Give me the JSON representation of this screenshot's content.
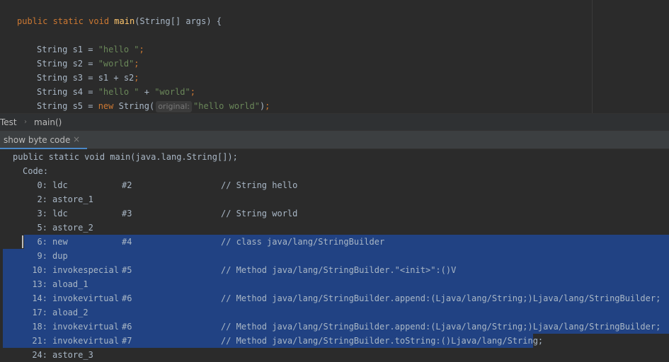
{
  "editor": {
    "lines": [
      {
        "parts": [
          {
            "text": "public static void ",
            "cls": "kw"
          },
          {
            "text": "main",
            "cls": "fn"
          },
          {
            "text": "(String[] args) {",
            "cls": "plain"
          }
        ]
      },
      {
        "parts": [
          {
            "text": "String s1 = ",
            "cls": "plain"
          },
          {
            "text": "\"hello \"",
            "cls": "str"
          },
          {
            "text": ";",
            "cls": "kw"
          }
        ]
      },
      {
        "parts": [
          {
            "text": "String s2 = ",
            "cls": "plain"
          },
          {
            "text": "\"world\"",
            "cls": "str"
          },
          {
            "text": ";",
            "cls": "kw"
          }
        ]
      },
      {
        "parts": [
          {
            "text": "String s3 = s1 + s2",
            "cls": "plain"
          },
          {
            "text": ";",
            "cls": "kw"
          }
        ]
      },
      {
        "parts": [
          {
            "text": "String s4 = ",
            "cls": "plain"
          },
          {
            "text": "\"hello \"",
            "cls": "str"
          },
          {
            "text": " + ",
            "cls": "plain"
          },
          {
            "text": "\"world\"",
            "cls": "str"
          },
          {
            "text": ";",
            "cls": "kw"
          }
        ]
      },
      {
        "parts": [
          {
            "text": "String s5 = ",
            "cls": "plain"
          },
          {
            "text": "new ",
            "cls": "kw"
          },
          {
            "text": "String(",
            "cls": "plain"
          },
          {
            "text": "original:",
            "cls": "hint"
          },
          {
            "text": "\"hello world\"",
            "cls": "str"
          },
          {
            "text": ")",
            "cls": "plain"
          },
          {
            "text": ";",
            "cls": "kw"
          }
        ]
      }
    ]
  },
  "breadcrumb": {
    "class_name": "Test",
    "method_name": "main()"
  },
  "tool_window": {
    "tab_label": "show byte code",
    "close_glyph": "×"
  },
  "bytecode": {
    "signature": "public static void main(java.lang.String[]);",
    "code_label": "Code:",
    "instructions": [
      {
        "offset": "0:",
        "op": "ldc",
        "arg": "#2",
        "comment": "// String hello",
        "selected": false
      },
      {
        "offset": "2:",
        "op": "astore_1",
        "arg": "",
        "comment": "",
        "selected": false
      },
      {
        "offset": "3:",
        "op": "ldc",
        "arg": "#3",
        "comment": "// String world",
        "selected": false
      },
      {
        "offset": "5:",
        "op": "astore_2",
        "arg": "",
        "comment": "",
        "selected": false
      },
      {
        "offset": "6:",
        "op": "new",
        "arg": "#4",
        "comment": "// class java/lang/StringBuilder",
        "selected": true
      },
      {
        "offset": "9:",
        "op": "dup",
        "arg": "",
        "comment": "",
        "selected": true
      },
      {
        "offset": "10:",
        "op": "invokespecial",
        "arg": "#5",
        "comment": "// Method java/lang/StringBuilder.\"<init>\":()V",
        "selected": true
      },
      {
        "offset": "13:",
        "op": "aload_1",
        "arg": "",
        "comment": "",
        "selected": true
      },
      {
        "offset": "14:",
        "op": "invokevirtual",
        "arg": "#6",
        "comment": "// Method java/lang/StringBuilder.append:(Ljava/lang/String;)Ljava/lang/StringBuilder;",
        "selected": true
      },
      {
        "offset": "17:",
        "op": "aload_2",
        "arg": "",
        "comment": "",
        "selected": true
      },
      {
        "offset": "18:",
        "op": "invokevirtual",
        "arg": "#6",
        "comment": "// Method java/lang/StringBuilder.append:(Ljava/lang/String;)Ljava/lang/StringBuilder;",
        "selected": true
      },
      {
        "offset": "21:",
        "op": "invokevirtual",
        "arg": "#7",
        "comment": "// Method java/lang/StringBuilder.toString:()Ljava/lang/String;",
        "selected": "partial"
      },
      {
        "offset": "24:",
        "op": "astore_3",
        "arg": "",
        "comment": "",
        "selected": false
      }
    ]
  },
  "colors": {
    "background": "#2b2b2b",
    "keyword": "#cc7832",
    "method": "#ffc66d",
    "string": "#6a8759",
    "text": "#a9b7c6",
    "selection": "#214283",
    "tab_underline": "#4a88c7"
  }
}
